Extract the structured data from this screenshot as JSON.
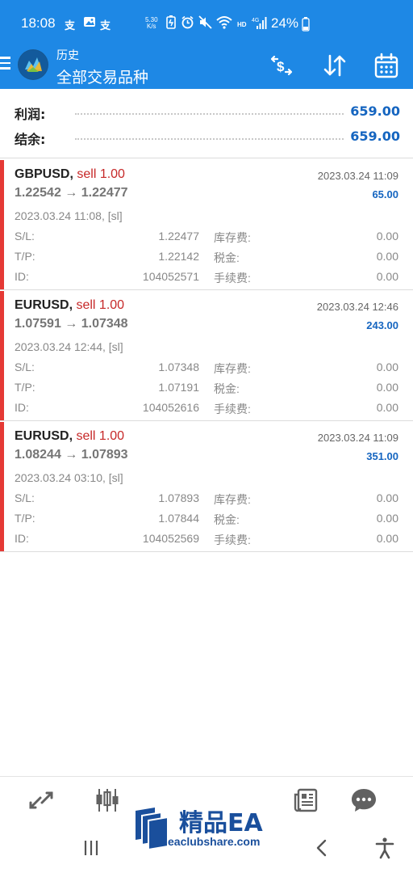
{
  "status_bar": {
    "time": "18:08",
    "notif_glyphs": [
      "支",
      "支"
    ],
    "net_speed_value": "5.30",
    "net_speed_unit": "K/s",
    "network_label": "HD",
    "signal_label": "4G",
    "battery": "24%"
  },
  "toolbar": {
    "subtitle": "历史",
    "title": "全部交易品种",
    "icons": [
      "menu-icon",
      "currency-icon",
      "sort-icon",
      "calendar-icon"
    ]
  },
  "summary": {
    "profit_label": "利润:",
    "profit_value": "659.00",
    "balance_label": "结余:",
    "balance_value": "659.00"
  },
  "trades": [
    {
      "symbol": "GBPUSD,",
      "side": "sell 1.00",
      "close_time": "2023.03.24 11:09",
      "prices": "1.22542 → 1.22477",
      "profit": "65.00",
      "open_time": "2023.03.24 11:08, [sl]",
      "sl_label": "S/L:",
      "sl_value": "1.22477",
      "swap_label": "库存费:",
      "swap_value": "0.00",
      "tp_label": "T/P:",
      "tp_value": "1.22142",
      "tax_label": "税金:",
      "tax_value": "0.00",
      "id_label": "ID:",
      "id_value": "104052571",
      "fee_label": "手续费:",
      "fee_value": "0.00"
    },
    {
      "symbol": "EURUSD,",
      "side": "sell 1.00",
      "close_time": "2023.03.24 12:46",
      "prices": "1.07591 → 1.07348",
      "profit": "243.00",
      "open_time": "2023.03.24 12:44, [sl]",
      "sl_label": "S/L:",
      "sl_value": "1.07348",
      "swap_label": "库存费:",
      "swap_value": "0.00",
      "tp_label": "T/P:",
      "tp_value": "1.07191",
      "tax_label": "税金:",
      "tax_value": "0.00",
      "id_label": "ID:",
      "id_value": "104052616",
      "fee_label": "手续费:",
      "fee_value": "0.00"
    },
    {
      "symbol": "EURUSD,",
      "side": "sell 1.00",
      "close_time": "2023.03.24 11:09",
      "prices": "1.08244 → 1.07893",
      "profit": "351.00",
      "open_time": "2023.03.24 03:10, [sl]",
      "sl_label": "S/L:",
      "sl_value": "1.07893",
      "swap_label": "库存费:",
      "swap_value": "0.00",
      "tp_label": "T/P:",
      "tp_value": "1.07844",
      "tax_label": "税金:",
      "tax_value": "0.00",
      "id_label": "ID:",
      "id_value": "104052569",
      "fee_label": "手续费:",
      "fee_value": "0.00"
    }
  ],
  "watermark": {
    "title": "精品EA",
    "url": "eaclubshare.com"
  },
  "colors": {
    "accent": "#1e88e5",
    "profit": "#1565c0",
    "sell": "#c62828",
    "trade_bar": "#e53935"
  }
}
